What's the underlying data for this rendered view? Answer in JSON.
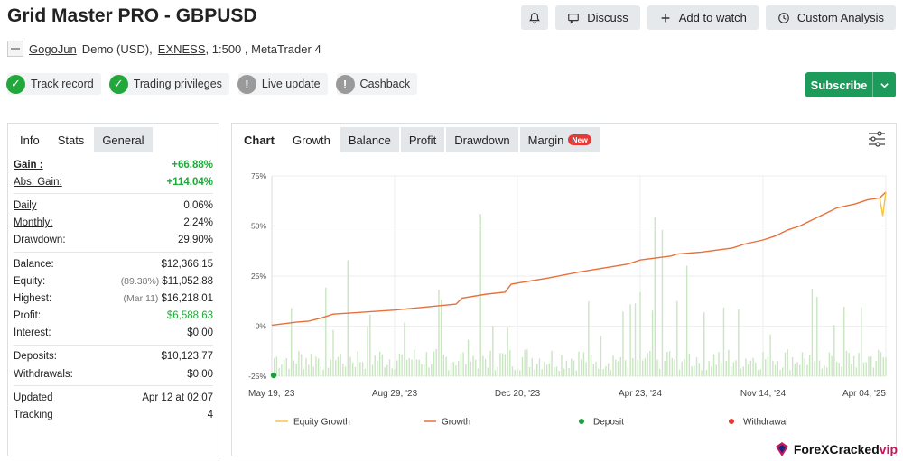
{
  "header": {
    "title": "Grid Master PRO - GBPUSD",
    "actions": {
      "discuss": "Discuss",
      "watch": "Add to watch",
      "custom": "Custom Analysis"
    }
  },
  "meta": {
    "author": "GogoJun",
    "account": "Demo (USD),",
    "broker": "EXNESS",
    "details": ", 1:500 , MetaTrader 4"
  },
  "badges": [
    {
      "label": "Track record",
      "state": "ok"
    },
    {
      "label": "Trading privileges",
      "state": "ok"
    },
    {
      "label": "Live update",
      "state": "warn"
    },
    {
      "label": "Cashback",
      "state": "warn"
    }
  ],
  "subscribe": {
    "label": "Subscribe"
  },
  "info_tabs": [
    "Info",
    "Stats",
    "General"
  ],
  "stats": {
    "gain": {
      "k": "Gain :",
      "v": "+66.88%"
    },
    "abs_gain": {
      "k": "Abs. Gain:",
      "v": "+114.04%"
    },
    "daily": {
      "k": "Daily",
      "v": "0.06%"
    },
    "monthly": {
      "k": "Monthly:",
      "v": "2.24%"
    },
    "drawdown": {
      "k": "Drawdown:",
      "v": "29.90%"
    },
    "balance": {
      "k": "Balance:",
      "v": "$12,366.15"
    },
    "equity": {
      "k": "Equity:",
      "pre": "(89.38%)",
      "v": "$11,052.88"
    },
    "highest": {
      "k": "Highest:",
      "pre": "(Mar 11)",
      "v": "$16,218.01"
    },
    "profit": {
      "k": "Profit:",
      "v": "$6,588.63"
    },
    "interest": {
      "k": "Interest:",
      "v": "$0.00"
    },
    "deposits": {
      "k": "Deposits:",
      "v": "$10,123.77"
    },
    "withdrawals": {
      "k": "Withdrawals:",
      "v": "$0.00"
    },
    "updated": {
      "k": "Updated",
      "v": "Apr 12 at 02:07"
    },
    "tracking": {
      "k": "Tracking",
      "v": "4"
    }
  },
  "chart_tabs": {
    "chart": "Chart",
    "growth": "Growth",
    "balance": "Balance",
    "profit": "Profit",
    "drawdown": "Drawdown",
    "margin": "Margin",
    "new": "New"
  },
  "chart_data": {
    "type": "line",
    "x_ticks": [
      "May 19, '23",
      "Aug 29, '23",
      "Dec 20, '23",
      "Apr 23, '24",
      "Nov 14, '24",
      "Apr 04, '25"
    ],
    "y_ticks": [
      "75%",
      "50%",
      "25%",
      "0%",
      "-25%"
    ],
    "ylim": [
      -25,
      75
    ],
    "legend": [
      "Equity Growth",
      "Growth",
      "Deposit",
      "Withdrawal"
    ],
    "series": [
      {
        "name": "Growth",
        "x": [
          0,
          0.04,
          0.06,
          0.08,
          0.1,
          0.2,
          0.3,
          0.31,
          0.35,
          0.38,
          0.39,
          0.45,
          0.5,
          0.56,
          0.58,
          0.6,
          0.65,
          0.66,
          0.7,
          0.75,
          0.77,
          0.8,
          0.82,
          0.84,
          0.86,
          0.88,
          0.9,
          0.92,
          0.95,
          0.97,
          0.99,
          1.0
        ],
        "values": [
          0.5,
          2,
          2.5,
          4,
          6,
          8,
          11,
          14,
          16,
          17,
          21,
          24,
          27,
          30,
          31,
          33,
          35,
          36,
          37,
          39,
          41,
          43,
          45,
          48,
          50,
          53,
          56,
          59,
          61,
          63,
          64,
          66.9
        ]
      },
      {
        "name": "Equity Growth",
        "x": [
          0.99,
          0.995,
          1.0
        ],
        "values": [
          64,
          55,
          66.9
        ]
      }
    ],
    "colors": {
      "growth": "#e8703a",
      "equity": "#f5c542",
      "deposit": "#1aa03a",
      "withdrawal": "#e53935",
      "bars": "#c8e6c0"
    }
  },
  "watermark": {
    "brand": "ForeXCracked",
    "suffix": "vip"
  }
}
